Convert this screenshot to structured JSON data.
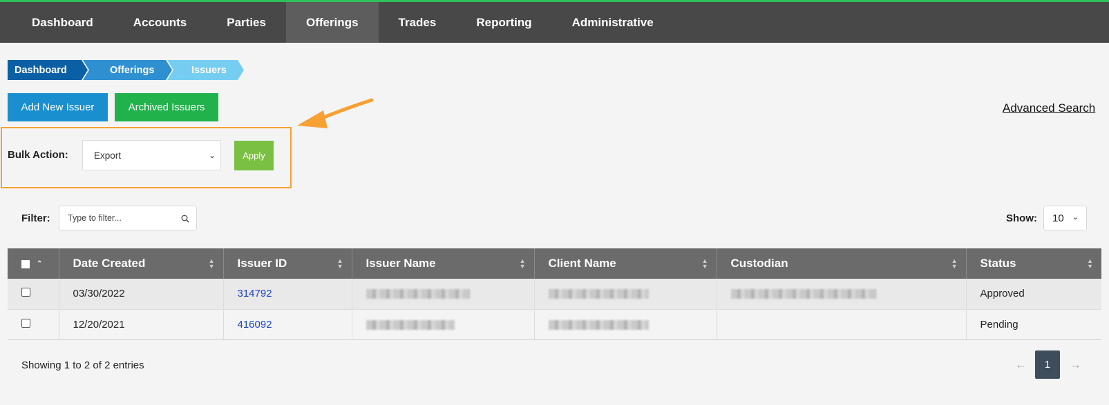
{
  "nav": {
    "items": [
      {
        "label": "Dashboard"
      },
      {
        "label": "Accounts"
      },
      {
        "label": "Parties"
      },
      {
        "label": "Offerings",
        "active": true
      },
      {
        "label": "Trades"
      },
      {
        "label": "Reporting"
      },
      {
        "label": "Administrative"
      }
    ]
  },
  "breadcrumb": [
    "Dashboard",
    "Offerings",
    "Issuers"
  ],
  "actions": {
    "add_label": "Add New Issuer",
    "archived_label": "Archived Issuers",
    "advanced_search": "Advanced Search"
  },
  "bulk": {
    "label": "Bulk Action:",
    "selected": "Export",
    "apply_label": "Apply"
  },
  "filter": {
    "label": "Filter:",
    "placeholder": "Type to filter..."
  },
  "show": {
    "label": "Show:",
    "value": "10"
  },
  "table": {
    "columns": [
      "Date Created",
      "Issuer ID",
      "Issuer Name",
      "Client Name",
      "Custodian",
      "Status"
    ],
    "rows": [
      {
        "date": "03/30/2022",
        "issuer_id": "314792",
        "status": "Approved"
      },
      {
        "date": "12/20/2021",
        "issuer_id": "416092",
        "status": "Pending"
      }
    ]
  },
  "footer": {
    "showing": "Showing 1 to 2 of 2 entries",
    "page": "1",
    "prev": "←",
    "next": "→"
  },
  "colors": {
    "accent_green": "#2fc05a",
    "highlight_orange": "#f7a033",
    "nav_bg": "#484848"
  }
}
